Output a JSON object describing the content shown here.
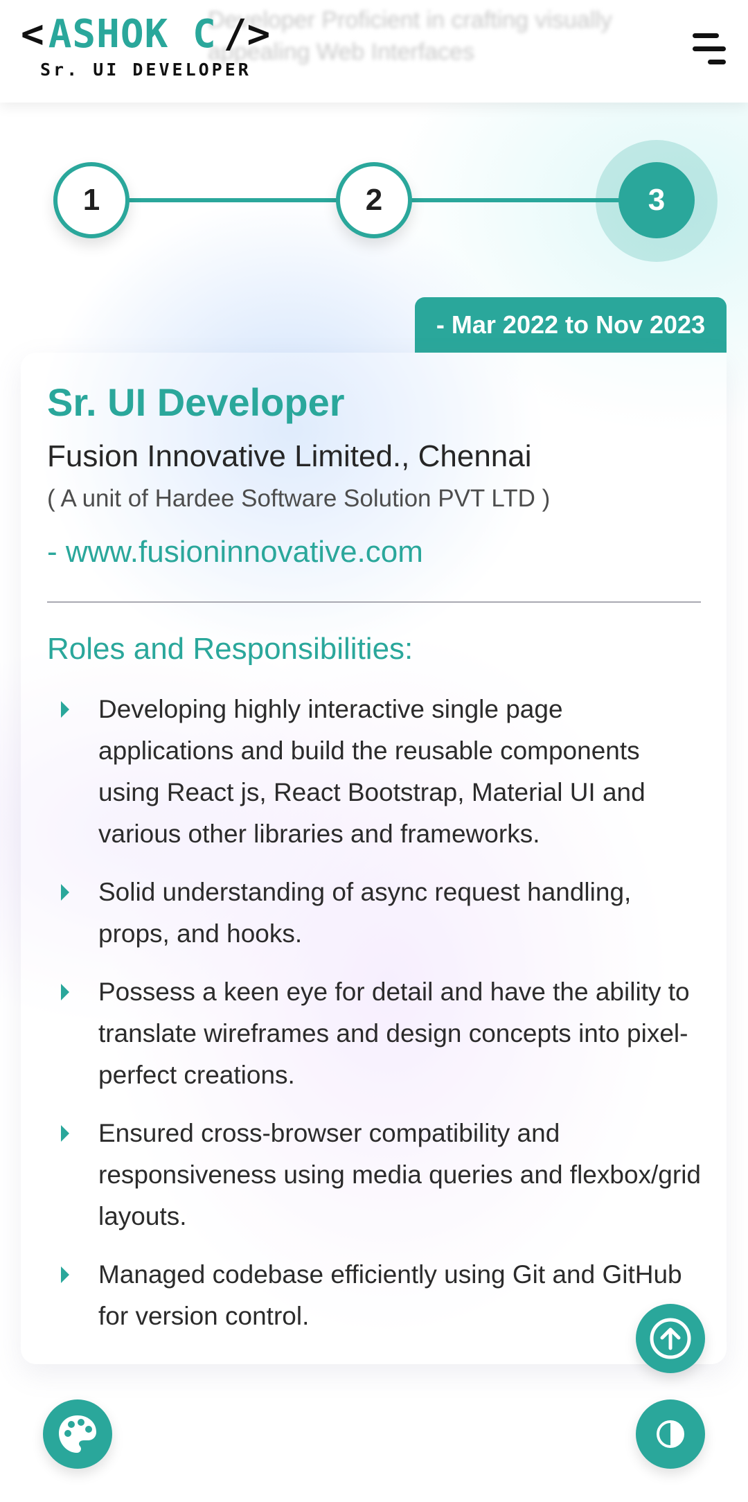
{
  "header": {
    "background_text": "Developer Proficient in crafting visually appealing Web Interfaces",
    "logo_open": "<",
    "logo_name": "ASHOK C",
    "logo_close": "/>",
    "logo_subtitle": "Sr. UI DEVELOPER",
    "menu_icon": "hamburger-menu-icon"
  },
  "stepper": {
    "steps": [
      "1",
      "2",
      "3"
    ],
    "active_step": 3
  },
  "experience": {
    "date_range": "- Mar 2022 to Nov 2023",
    "title": "Sr. UI Developer",
    "company": "Fusion Innovative Limited., Chennai",
    "unit": "( A unit of Hardee Software Solution PVT LTD )",
    "website": "- www.fusioninnovative.com",
    "roles_heading": "Roles and Responsibilities:",
    "responsibilities": [
      "Developing highly interactive single page applications and build the reusable components using React js, React Bootstrap, Material UI and various other libraries and frameworks.",
      "Solid understanding of async request handling, props, and hooks.",
      "Possess a keen eye for detail and have the ability to translate wireframes and design concepts into pixel-perfect creations.",
      "Ensured cross-browser compatibility and responsiveness using media queries and flexbox/grid layouts.",
      "Managed codebase efficiently using Git and GitHub for version control."
    ]
  },
  "buttons": {
    "scroll_top_icon": "arrow-up-circle-icon",
    "palette_icon": "palette-icon",
    "theme_toggle_icon": "contrast-icon"
  },
  "colors": {
    "accent": "#2aa79b",
    "text": "#2a2a2a"
  }
}
